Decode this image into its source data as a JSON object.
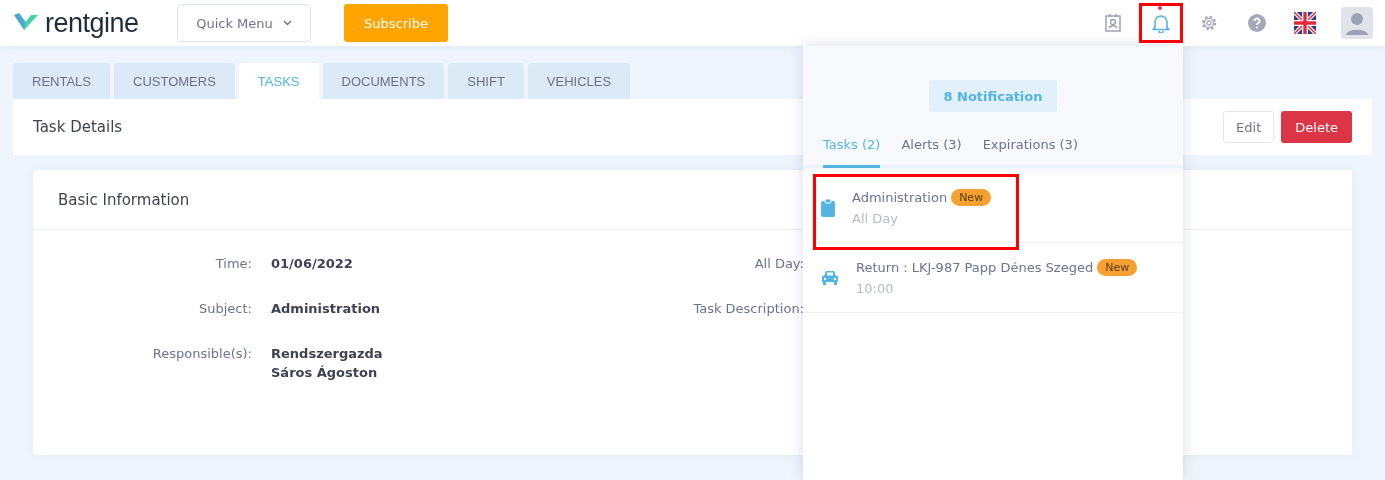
{
  "header": {
    "logo": "rentgine",
    "quick_menu": "Quick Menu",
    "subscribe": "Subscribe",
    "bell_highlighted": true,
    "bell_unread": true
  },
  "tabs": [
    {
      "label": "RENTALS",
      "selected": false
    },
    {
      "label": "CUSTOMERS",
      "selected": false
    },
    {
      "label": "TASKS",
      "selected": true
    },
    {
      "label": "DOCUMENTS",
      "selected": false
    },
    {
      "label": "SHIFT",
      "selected": false
    },
    {
      "label": "VEHICLES",
      "selected": false
    }
  ],
  "task_details": {
    "title": "Task Details",
    "buttons": [
      {
        "label": "Edit",
        "kind": "outline"
      },
      {
        "label": "Delete",
        "kind": "danger"
      }
    ]
  },
  "basic_information": {
    "title": "Basic Information",
    "rows": [
      {
        "label": "Time:",
        "values": [
          "01/06/2022"
        ],
        "label_2": "All Day:"
      },
      {
        "label": "Subject:",
        "values": [
          "Administration"
        ],
        "label_2": "Task Description:"
      },
      {
        "label": "Responsible(s):",
        "values": [
          "Rendszergazda",
          "Sáros Ágoston"
        ]
      }
    ]
  },
  "notifications": {
    "count": "8 Notification",
    "tabs": [
      {
        "label": "Tasks (2)",
        "selected": true
      },
      {
        "label": "Alerts (3)",
        "selected": false
      },
      {
        "label": "Expirations (3)",
        "selected": false
      }
    ],
    "items": [
      {
        "kind": "task",
        "title": "Administration",
        "badge": "New",
        "time": "All Day",
        "highlighted": true
      },
      {
        "kind": "vehicle",
        "title": "Return : LKJ-987 Papp Dénes Szeged",
        "badge": "New",
        "time": "10:00",
        "highlighted": false
      }
    ]
  }
}
